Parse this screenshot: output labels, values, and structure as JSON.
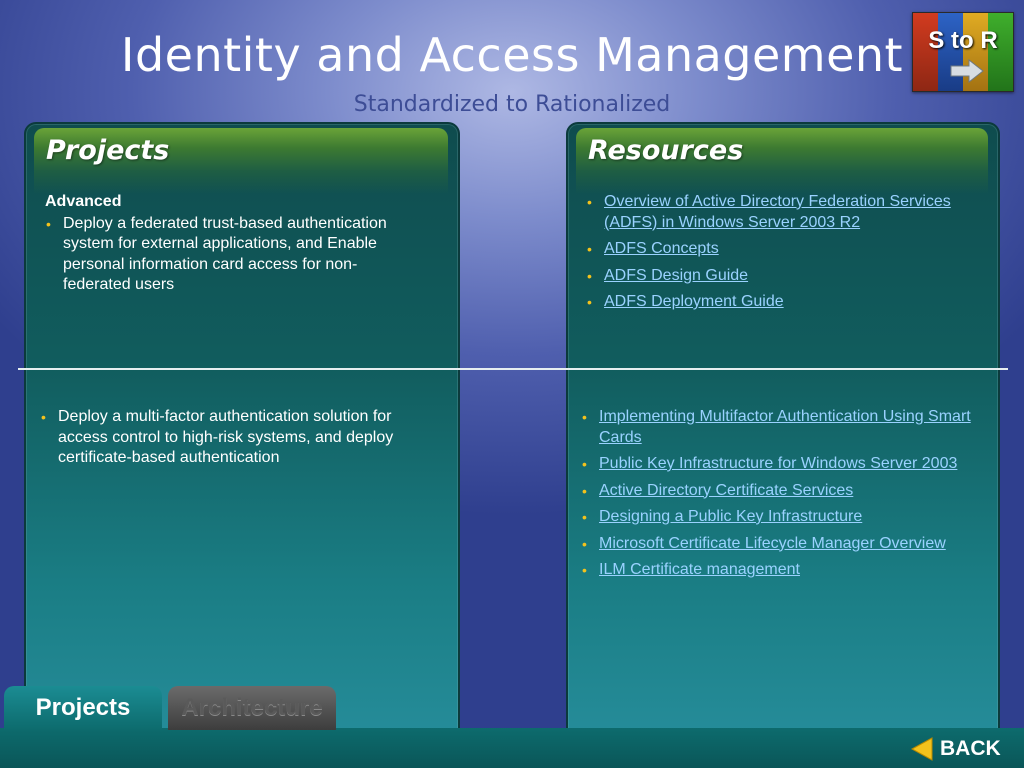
{
  "header": {
    "title": "Identity and Access Management",
    "subtitle": "Standardized to Rationalized",
    "logo_text": "S to R",
    "logo_icon": "arrow-right-icon"
  },
  "projects_panel": {
    "label": "Projects",
    "top_section": {
      "heading": "Advanced",
      "items": [
        "Deploy a federated trust-based authentication system for external applications, and Enable personal information card access for non-federated users"
      ]
    },
    "bottom_section": {
      "items": [
        "Deploy a multi-factor authentication solution for access control to high-risk systems, and deploy certificate-based authentication"
      ]
    }
  },
  "resources_panel": {
    "label": "Resources",
    "top_links": [
      "Overview of Active Directory Federation Services (ADFS) in Windows Server 2003 R2",
      "ADFS Concepts",
      "ADFS Design Guide",
      "ADFS Deployment Guide"
    ],
    "bottom_links": [
      "Implementing Multifactor Authentication Using Smart Cards",
      "Public Key Infrastructure for Windows Server 2003",
      "Active Directory Certificate Services",
      "Designing a Public Key Infrastructure",
      "Microsoft Certificate Lifecycle Manager Overview",
      "ILM  Certificate management"
    ]
  },
  "tabs": [
    {
      "label": "Projects",
      "active": true
    },
    {
      "label": "Architecture",
      "active": false
    }
  ],
  "nav": {
    "back_label": "BACK",
    "back_icon": "triangle-left-icon"
  },
  "colors": {
    "bullet": "#f3c21c",
    "link": "#9ad2ff",
    "panel": "#115d5e",
    "header_green": "#6aa338"
  }
}
